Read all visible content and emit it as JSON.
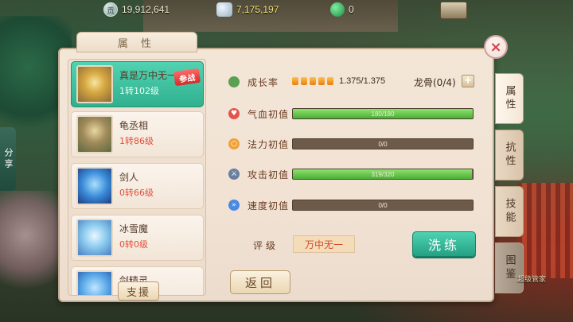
{
  "currencies": [
    {
      "icon": "silver-coin-icon",
      "glyph": "贡",
      "amount": "19,912,641"
    },
    {
      "icon": "silver-ingot-icon",
      "glyph": "",
      "amount": "7,175,197"
    },
    {
      "icon": "green-gem-icon",
      "glyph": "",
      "amount": "0"
    }
  ],
  "panel": {
    "title": "属 性"
  },
  "pets": [
    {
      "name": "真是万中无一",
      "level": "1转102级",
      "badge": "参战",
      "selected": true
    },
    {
      "name": "龟丞相",
      "level": "1转86级"
    },
    {
      "name": "剑人",
      "level": "0转66级"
    },
    {
      "name": "冰雪魔",
      "level": "0转0级"
    },
    {
      "name": "剑精灵",
      "level": ""
    }
  ],
  "support_button": "支援",
  "stats": {
    "growth": {
      "label": "成长率",
      "value": "1.375/1.375",
      "gems": 5
    },
    "dragon_bone": "龙骨(0/4)",
    "plus": "+",
    "rows": [
      {
        "label": "气血初值",
        "value": "180/180",
        "fraction": 1.0,
        "color": "#e3544a",
        "icon": "heart-icon"
      },
      {
        "label": "法力初值",
        "value": "0/0",
        "fraction": 0,
        "color": "#f0a23a",
        "icon": "mana-icon"
      },
      {
        "label": "攻击初值",
        "value": "319/320",
        "fraction": 0.997,
        "color": "#6a7fa0",
        "icon": "sword-icon"
      },
      {
        "label": "速度初值",
        "value": "0/0",
        "fraction": 0,
        "color": "#4a8ae0",
        "icon": "speed-icon"
      }
    ]
  },
  "rating": {
    "label": "评级",
    "value": "万中无一"
  },
  "buttons": {
    "wash": "洗练",
    "back": "返回",
    "close": "×"
  },
  "tabs": [
    {
      "label": "属性",
      "active": true
    },
    {
      "label": "抗性"
    },
    {
      "label": "技能"
    },
    {
      "label": "图鉴"
    }
  ],
  "share": "分享",
  "corner": "超级管家"
}
